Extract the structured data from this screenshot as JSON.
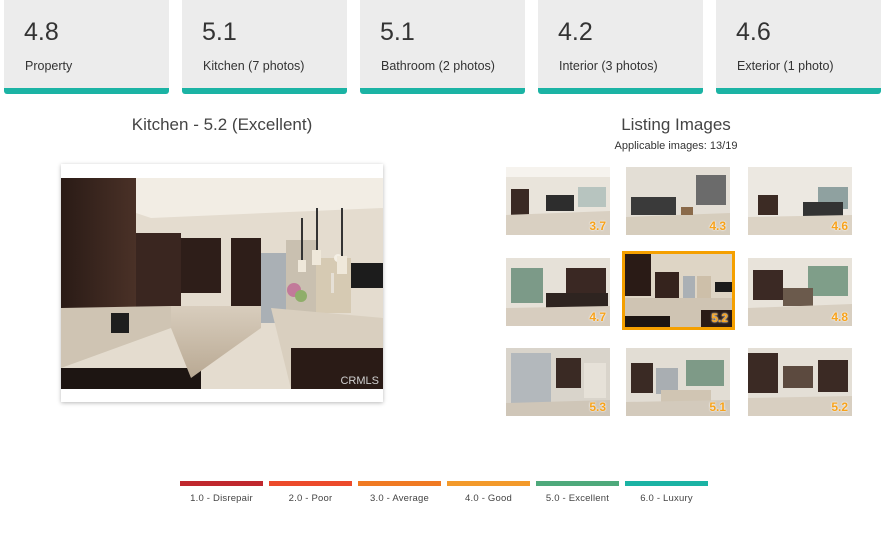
{
  "cards": [
    {
      "score": "4.8",
      "label": "Property"
    },
    {
      "score": "5.1",
      "label": "Kitchen (7 photos)"
    },
    {
      "score": "5.1",
      "label": "Bathroom (2 photos)"
    },
    {
      "score": "4.2",
      "label": "Interior (3 photos)"
    },
    {
      "score": "4.6",
      "label": "Exterior (1 photo)"
    }
  ],
  "selected_photo": {
    "title": "Kitchen - 5.2 (Excellent)",
    "watermark": "CRMLS"
  },
  "listing": {
    "title": "Listing Images",
    "applicable": "Applicable images: 13/19",
    "thumbnails": [
      {
        "score": "3.7",
        "scene": "living-room"
      },
      {
        "score": "4.3",
        "scene": "living-room"
      },
      {
        "score": "4.6",
        "scene": "living-room"
      },
      {
        "score": "4.7",
        "scene": "kitchen"
      },
      {
        "score": "5.2",
        "scene": "kitchen",
        "selected": true
      },
      {
        "score": "4.8",
        "scene": "kitchen"
      },
      {
        "score": "5.3",
        "scene": "kitchen"
      },
      {
        "score": "5.1",
        "scene": "kitchen"
      },
      {
        "score": "5.2",
        "scene": "kitchen"
      }
    ]
  },
  "legend": [
    {
      "label": "1.0 - Disrepair",
      "color": "#c0282e"
    },
    {
      "label": "2.0 - Poor",
      "color": "#ec4a2b"
    },
    {
      "label": "3.0 - Average",
      "color": "#f07a22"
    },
    {
      "label": "4.0 - Good",
      "color": "#f39a2b"
    },
    {
      "label": "5.0 - Excellent",
      "color": "#4ea97b"
    },
    {
      "label": "6.0 - Luxury",
      "color": "#1bb3a4"
    }
  ],
  "colors": {
    "card_background": "#ececec",
    "card_accent": "#1bb3a4",
    "selected_outline": "#f5a000",
    "thumb_score": "#f7a21b"
  }
}
